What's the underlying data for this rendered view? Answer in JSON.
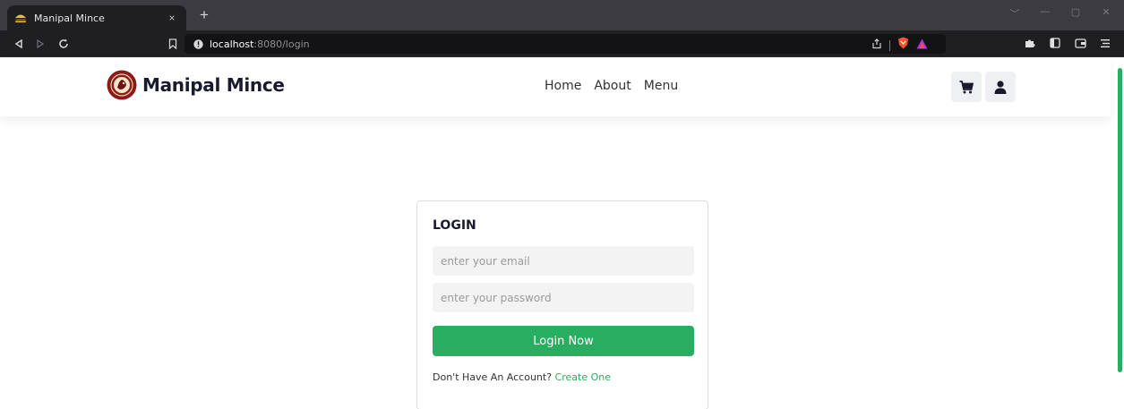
{
  "browser": {
    "tab": {
      "title": "Manipal Mince",
      "close_symbol": "×",
      "favicon": "burger-favicon-icon"
    },
    "new_tab_symbol": "+",
    "address": {
      "host": "localhost",
      "rest": ":8080/login"
    },
    "window_controls": [
      "﹀",
      "—",
      "▢",
      "✕"
    ]
  },
  "site": {
    "brand_name": "Manipal Mince",
    "nav": [
      {
        "label": "Home"
      },
      {
        "label": "About"
      },
      {
        "label": "Menu"
      }
    ],
    "icons": {
      "cart": "cart-icon",
      "user": "user-icon"
    },
    "accent_color": "#27ae60"
  },
  "login": {
    "title": "LOGIN",
    "email_placeholder": "enter your email",
    "password_placeholder": "enter your password",
    "button_label": "Login Now",
    "account_prompt": "Don't Have An Account?",
    "create_link": "Create One"
  }
}
